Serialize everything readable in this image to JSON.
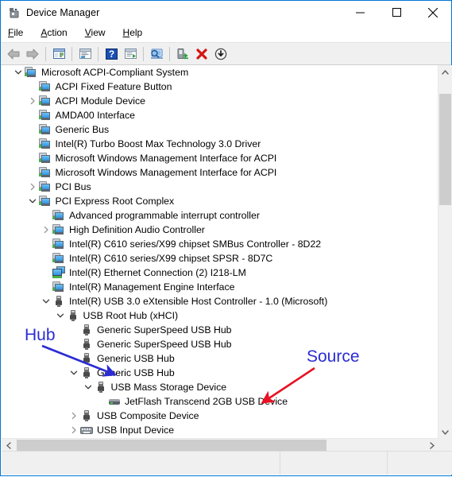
{
  "window": {
    "title": "Device Manager",
    "icon": "device-manager-icon",
    "minimize_label": "Minimize",
    "maximize_label": "Maximize",
    "close_label": "Close"
  },
  "menu": {
    "items": [
      {
        "label": "File",
        "accesskey": "F",
        "rest": "ile"
      },
      {
        "label": "Action",
        "accesskey": "A",
        "rest": "ction"
      },
      {
        "label": "View",
        "accesskey": "V",
        "rest": "iew"
      },
      {
        "label": "Help",
        "accesskey": "H",
        "rest": "elp"
      }
    ]
  },
  "toolbar": {
    "buttons": [
      {
        "name": "back-button",
        "icon": "back-arrow-icon"
      },
      {
        "name": "forward-button",
        "icon": "forward-arrow-icon"
      },
      {
        "name": "show-hide-tree-button",
        "icon": "tree-pane-icon"
      },
      {
        "name": "properties-button",
        "icon": "properties-icon"
      },
      {
        "name": "help-button",
        "icon": "help-question-icon"
      },
      {
        "name": "update-driver-button",
        "icon": "update-driver-icon"
      },
      {
        "name": "scan-hardware-button",
        "icon": "scan-monitor-icon"
      },
      {
        "name": "enable-device-button",
        "icon": "enable-device-icon"
      },
      {
        "name": "uninstall-device-button",
        "icon": "red-x-icon"
      },
      {
        "name": "disable-device-button",
        "icon": "down-arrow-circle-icon"
      }
    ]
  },
  "tree": {
    "rows": [
      {
        "label": "Microsoft ACPI-Compliant System",
        "indent": 2,
        "icon": "device-icon",
        "expander": "expanded"
      },
      {
        "label": "ACPI Fixed Feature Button",
        "indent": 3,
        "icon": "device-icon",
        "expander": "none"
      },
      {
        "label": "ACPI Module Device",
        "indent": 3,
        "icon": "device-icon",
        "expander": "collapsed"
      },
      {
        "label": "AMDA00 Interface",
        "indent": 3,
        "icon": "device-icon",
        "expander": "none"
      },
      {
        "label": "Generic Bus",
        "indent": 3,
        "icon": "device-icon",
        "expander": "none"
      },
      {
        "label": "Intel(R) Turbo Boost Max Technology 3.0 Driver",
        "indent": 3,
        "icon": "device-icon",
        "expander": "none"
      },
      {
        "label": "Microsoft Windows Management Interface for ACPI",
        "indent": 3,
        "icon": "device-icon",
        "expander": "none"
      },
      {
        "label": "Microsoft Windows Management Interface for ACPI",
        "indent": 3,
        "icon": "device-icon",
        "expander": "none"
      },
      {
        "label": "PCI Bus",
        "indent": 3,
        "icon": "device-icon",
        "expander": "collapsed"
      },
      {
        "label": "PCI Express Root Complex",
        "indent": 3,
        "icon": "device-icon",
        "expander": "expanded"
      },
      {
        "label": "Advanced programmable interrupt controller",
        "indent": 4,
        "icon": "device-icon",
        "expander": "none"
      },
      {
        "label": "High Definition Audio Controller",
        "indent": 4,
        "icon": "device-icon",
        "expander": "collapsed"
      },
      {
        "label": "Intel(R) C610 series/X99 chipset SMBus Controller - 8D22",
        "indent": 4,
        "icon": "device-icon",
        "expander": "none"
      },
      {
        "label": "Intel(R) C610 series/X99 chipset SPSR - 8D7C",
        "indent": 4,
        "icon": "device-icon",
        "expander": "none"
      },
      {
        "label": "Intel(R) Ethernet Connection (2) I218-LM",
        "indent": 4,
        "icon": "network-icon",
        "expander": "none"
      },
      {
        "label": "Intel(R) Management Engine Interface",
        "indent": 4,
        "icon": "device-icon",
        "expander": "none"
      },
      {
        "label": "Intel(R) USB 3.0 eXtensible Host Controller - 1.0 (Microsoft)",
        "indent": 4,
        "icon": "usb-icon",
        "expander": "expanded"
      },
      {
        "label": "USB Root Hub (xHCI)",
        "indent": 5,
        "icon": "usb-icon",
        "expander": "expanded"
      },
      {
        "label": "Generic SuperSpeed USB Hub",
        "indent": 6,
        "icon": "usb-icon",
        "expander": "none"
      },
      {
        "label": "Generic SuperSpeed USB Hub",
        "indent": 6,
        "icon": "usb-icon",
        "expander": "none"
      },
      {
        "label": "Generic USB Hub",
        "indent": 6,
        "icon": "usb-icon",
        "expander": "none"
      },
      {
        "label": "Generic USB Hub",
        "indent": 6,
        "icon": "usb-icon",
        "expander": "expanded"
      },
      {
        "label": "USB Mass Storage Device",
        "indent": 7,
        "icon": "usb-icon",
        "expander": "expanded"
      },
      {
        "label": "JetFlash Transcend 2GB USB Device",
        "indent": 8,
        "icon": "disk-drive-icon",
        "expander": "none"
      },
      {
        "label": "USB Composite Device",
        "indent": 6,
        "icon": "usb-icon",
        "expander": "collapsed"
      },
      {
        "label": "USB Input Device",
        "indent": 6,
        "icon": "keyboard-icon",
        "expander": "collapsed"
      }
    ]
  },
  "annotations": [
    {
      "name": "hub-annotation",
      "text": "Hub",
      "color": "#2b2bd4",
      "arrow_color": "#2b2bd4"
    },
    {
      "name": "source-annotation",
      "text": "Source",
      "color": "#2b2bd4",
      "arrow_color": "#e81123"
    }
  ],
  "colors": {
    "window_border": "#0078d7",
    "toolbar_bg": "#f0f0f0",
    "scrollbar_thumb": "#cdcdcd",
    "annotation_blue": "#2b2bd4",
    "annotation_red": "#e81123"
  },
  "statusbar": {
    "pane1": "",
    "pane2": "",
    "pane3": ""
  }
}
